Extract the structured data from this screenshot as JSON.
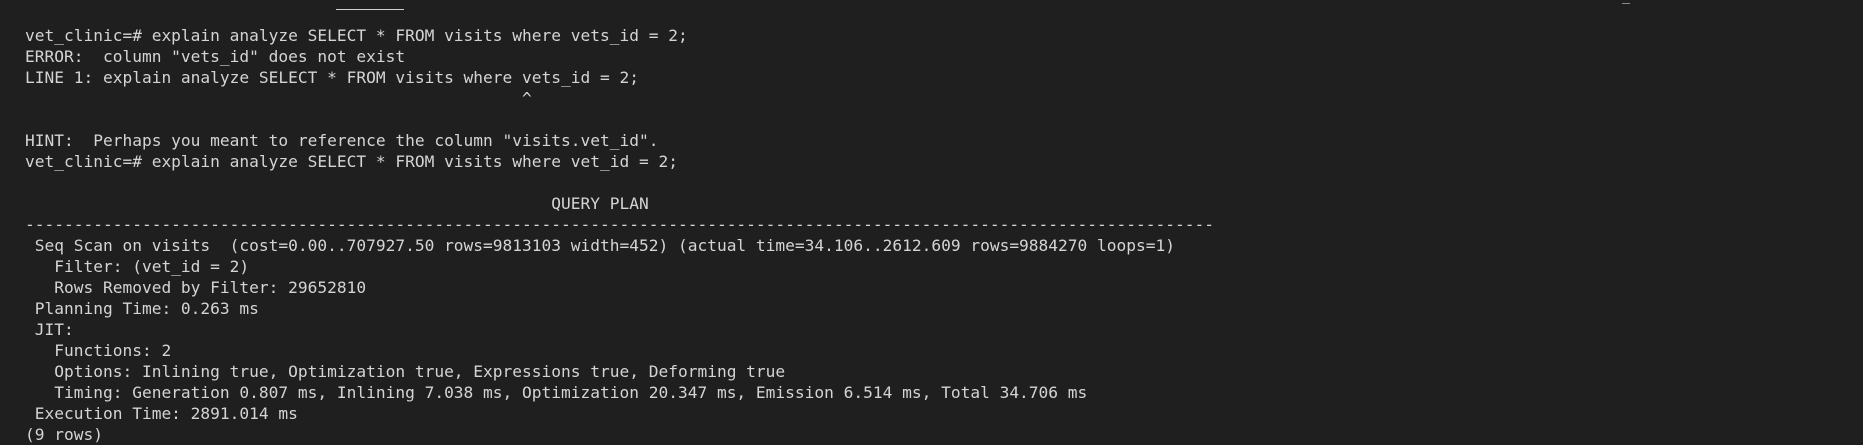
{
  "terminal": {
    "lines": [
      "vet_clinic=# explain analyze SELECT * FROM visits where vets_id = 2;",
      "ERROR:  column \"vets_id\" does not exist",
      "LINE 1: explain analyze SELECT * FROM visits where vets_id = 2;",
      "                                                   ^",
      "",
      "HINT:  Perhaps you meant to reference the column \"visits.vet_id\".",
      "vet_clinic=# explain analyze SELECT * FROM visits where vet_id = 2;",
      "",
      "                                                      QUERY PLAN",
      "--------------------------------------------------------------------------------------------------------------------------",
      " Seq Scan on visits  (cost=0.00..707927.50 rows=9813103 width=452) (actual time=34.106..2612.609 rows=9884270 loops=1)",
      "   Filter: (vet_id = 2)",
      "   Rows Removed by Filter: 29652810",
      " Planning Time: 0.263 ms",
      " JIT:",
      "   Functions: 2",
      "   Options: Inlining true, Optimization true, Expressions true, Deforming true",
      "   Timing: Generation 0.807 ms, Inlining 7.038 ms, Optimization 20.347 ms, Emission 6.514 ms, Total 34.706 ms",
      " Execution Time: 2891.014 ms",
      "(9 rows)"
    ]
  }
}
